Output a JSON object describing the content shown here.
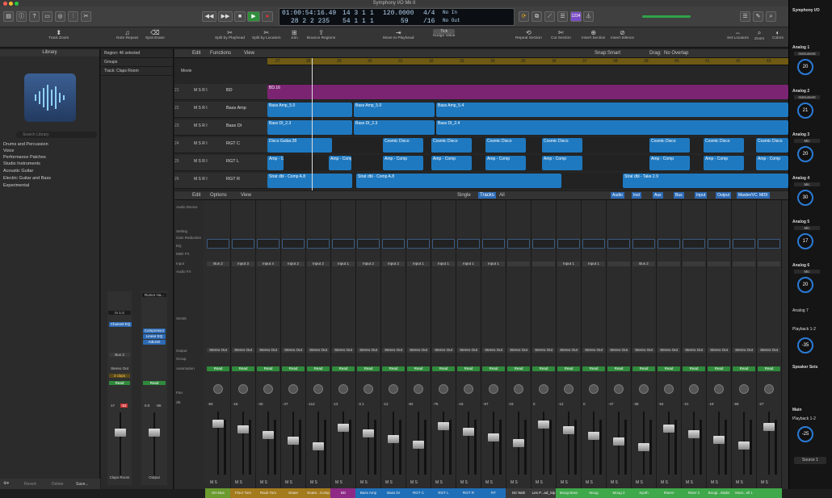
{
  "window": {
    "title": "Symphony I/O Mk II"
  },
  "lcd": {
    "time": "01:00:54:16.49",
    "time2": "28 2 2 235",
    "bars": "14 3 1",
    "bars2": "54 1 1",
    "beat": "1",
    "beat2": "1",
    "tempo": "120.0000",
    "tempo2": "59",
    "sig": "4/4",
    "sig2": "/16",
    "in": "No In",
    "out": "No Out"
  },
  "toolbar": {
    "tools": [
      "Track Zoom",
      "Note Repeat",
      "Spot Erase",
      "Split by Playhead",
      "Split by Locators",
      "Join",
      "Bounce Regions",
      "Move to Playhead",
      "Nudge Value",
      "Repeat Section",
      "Cut Section",
      "Insert Section",
      "Insert Silence",
      "Set Locators",
      "Zoom",
      "Colors"
    ],
    "nudge": "Tick"
  },
  "library": {
    "title": "Library",
    "search_placeholder": "Search Library",
    "items": [
      "Drums and Percussion",
      "Voice",
      "Performance Patches",
      "Studio Instruments",
      "Acoustic Guitar",
      "Electric Guitar and Bass",
      "Experimental"
    ],
    "buttons": [
      "Revert",
      "Delete",
      "Save..."
    ]
  },
  "inspector": {
    "region": "Region: 46 selected",
    "groups": "Groups",
    "track": "Track: Claps Room",
    "strip1": "Claps Room",
    "strip2": "Output",
    "input": "In 1-2",
    "bus": "Bus 3",
    "out1": "Stereo Out",
    "group": "3 claps",
    "read": "Read",
    "vals": [
      "17",
      "-52",
      "0.0",
      "-55"
    ],
    "plugins": [
      "Channel EQ"
    ],
    "plugins2": [
      "Compressor",
      "Linear EQ",
      "AdLimit"
    ],
    "drumroom": "Rumor Ha..."
  },
  "tracks": {
    "menu": [
      "Edit",
      "Functions",
      "View"
    ],
    "snap": "Smart",
    "drag": "No Overlap",
    "ruler": [
      "27",
      "28",
      "29",
      "30",
      "31",
      "32",
      "33",
      "34",
      "35",
      "36",
      "37",
      "38",
      "39",
      "40",
      "41",
      "42",
      "43"
    ],
    "movie": "Movie",
    "rows": [
      {
        "num": "21",
        "name": "BD",
        "color": "#8e2a86"
      },
      {
        "num": "22",
        "name": "Bass Amp",
        "color": "#1f7fc8"
      },
      {
        "num": "23",
        "name": "Bass DI",
        "color": "#1f7fc8"
      },
      {
        "num": "24",
        "name": "RGT C",
        "color": "#1f7fc8"
      },
      {
        "num": "25",
        "name": "RGT L",
        "color": "#1f7fc8"
      },
      {
        "num": "26",
        "name": "RGT R",
        "color": "#1f7fc8"
      }
    ],
    "regions": [
      "Bass Amp_5.0",
      "Bass Amp_5.4",
      "Bass DI_2.3",
      "Bass DI_2.4",
      "Disco Guitar.28",
      "Cosmic Disco",
      "Amp - Comp",
      "Strat dbl - Comp A.8",
      "Strat dbl - Take 2.9",
      "BD.16"
    ]
  },
  "mixer": {
    "menu": [
      "Edit",
      "Options",
      "View"
    ],
    "tabs": [
      "Single",
      "Tracks",
      "All"
    ],
    "filters": [
      "Audio",
      "Inst",
      "Aux",
      "Bus",
      "Input",
      "Output",
      "Master/VCA",
      "MIDI"
    ],
    "rowlabels": [
      "Audio Device",
      "Setting",
      "Gain Reduction",
      "EQ",
      "MIDI FX",
      "Input",
      "Audio FX",
      "Sends",
      "Output",
      "Group",
      "Automation",
      "Pan",
      "dB"
    ],
    "strips": [
      {
        "name": "DH Bus",
        "color": "#6b9b2f",
        "input": "Bus 2",
        "out": "Stereo Out",
        "db": "-50"
      },
      {
        "name": "Floor Tom",
        "color": "#a37a1c",
        "input": "Input 3",
        "out": "Stereo Out",
        "db": "-16"
      },
      {
        "name": "Rack Tom",
        "color": "#a37a1c",
        "input": "Input 4",
        "out": "Stereo Out",
        "db": "-40"
      },
      {
        "name": "Snare",
        "color": "#a37a1c",
        "input": "Input 2",
        "out": "Stereo Out",
        "db": "-47"
      },
      {
        "name": "Snare...Comp",
        "color": "#a37a1c",
        "input": "Input 2",
        "out": "Stereo Out",
        "db": "-112"
      },
      {
        "name": "BD",
        "color": "#8e2a86",
        "input": "Input 1",
        "out": "Stereo Out",
        "db": "-12"
      },
      {
        "name": "Bass Amp",
        "color": "#1f6fb8",
        "input": "Input 2",
        "out": "Stereo Out",
        "db": "-2.1"
      },
      {
        "name": "Bass DI",
        "color": "#1f6fb8",
        "input": "Input 2",
        "out": "Stereo Out",
        "db": "-12"
      },
      {
        "name": "RGT C",
        "color": "#1f6fb8",
        "input": "Input 1",
        "out": "Stereo Out",
        "db": "-62"
      },
      {
        "name": "RGT L",
        "color": "#1f6fb8",
        "input": "Input 1",
        "out": "Stereo Out",
        "db": "-75"
      },
      {
        "name": "RGT R",
        "color": "#1f6fb8",
        "input": "Input 1",
        "out": "Stereo Out",
        "db": "-15"
      },
      {
        "name": "RT",
        "color": "#1f6fb8",
        "input": "Input 1",
        "out": "Stereo Out",
        "db": "-57"
      },
      {
        "name": "Gtr Wah",
        "color": "#3a3a3a",
        "input": "",
        "out": "Stereo Out",
        "db": "-19"
      },
      {
        "name": "Les P...ad_Sip",
        "color": "#3a3a3a",
        "input": "",
        "out": "Stereo Out",
        "db": "0"
      },
      {
        "name": "Moog Bass",
        "color": "#3ea84a",
        "input": "Input 1",
        "out": "Stereo Out",
        "db": "-12"
      },
      {
        "name": "Moog",
        "color": "#3ea84a",
        "input": "Input 1",
        "out": "Stereo Out",
        "db": "0"
      },
      {
        "name": "Moog 2",
        "color": "#3ea84a",
        "input": "",
        "out": "Stereo Out",
        "db": "-47"
      },
      {
        "name": "Synth",
        "color": "#3ea84a",
        "input": "Bus 2",
        "out": "Stereo Out",
        "db": "-35"
      },
      {
        "name": "Risers",
        "color": "#3ea84a",
        "input": "",
        "out": "Stereo Out",
        "db": "-54"
      },
      {
        "name": "Riser 2",
        "color": "#3ea84a",
        "input": "",
        "out": "Stereo Out",
        "db": "-21"
      },
      {
        "name": "Boogi...Stabs",
        "color": "#3ea84a",
        "input": "",
        "out": "Stereo Out",
        "db": "-19"
      },
      {
        "name": "Must...ell 1",
        "color": "#3ea84a",
        "input": "",
        "out": "Stereo Out",
        "db": "-59"
      },
      {
        "name": "",
        "color": "#3ea84a",
        "input": "",
        "out": "Stereo Out",
        "db": "-27"
      }
    ]
  },
  "rightpanel": {
    "title": "Symphony I/O",
    "channels": [
      {
        "label": "Analog 1",
        "type": "Instrument",
        "val": "20"
      },
      {
        "label": "Analog 2",
        "type": "Instrument",
        "val": "21"
      },
      {
        "label": "Analog 3",
        "type": "Mic",
        "val": "20"
      },
      {
        "label": "Analog 4",
        "type": "Mic",
        "val": "30"
      },
      {
        "label": "Analog 5",
        "type": "Mic",
        "val": "17"
      },
      {
        "label": "Analog 6",
        "type": "Mic",
        "val": "20"
      }
    ],
    "analog7": "Analog 7",
    "playback": "Playback 1-2",
    "pbval": "-35",
    "speaker": "Speaker Sets",
    "main": "Main",
    "mainval": "-25",
    "source": "Source 1"
  }
}
